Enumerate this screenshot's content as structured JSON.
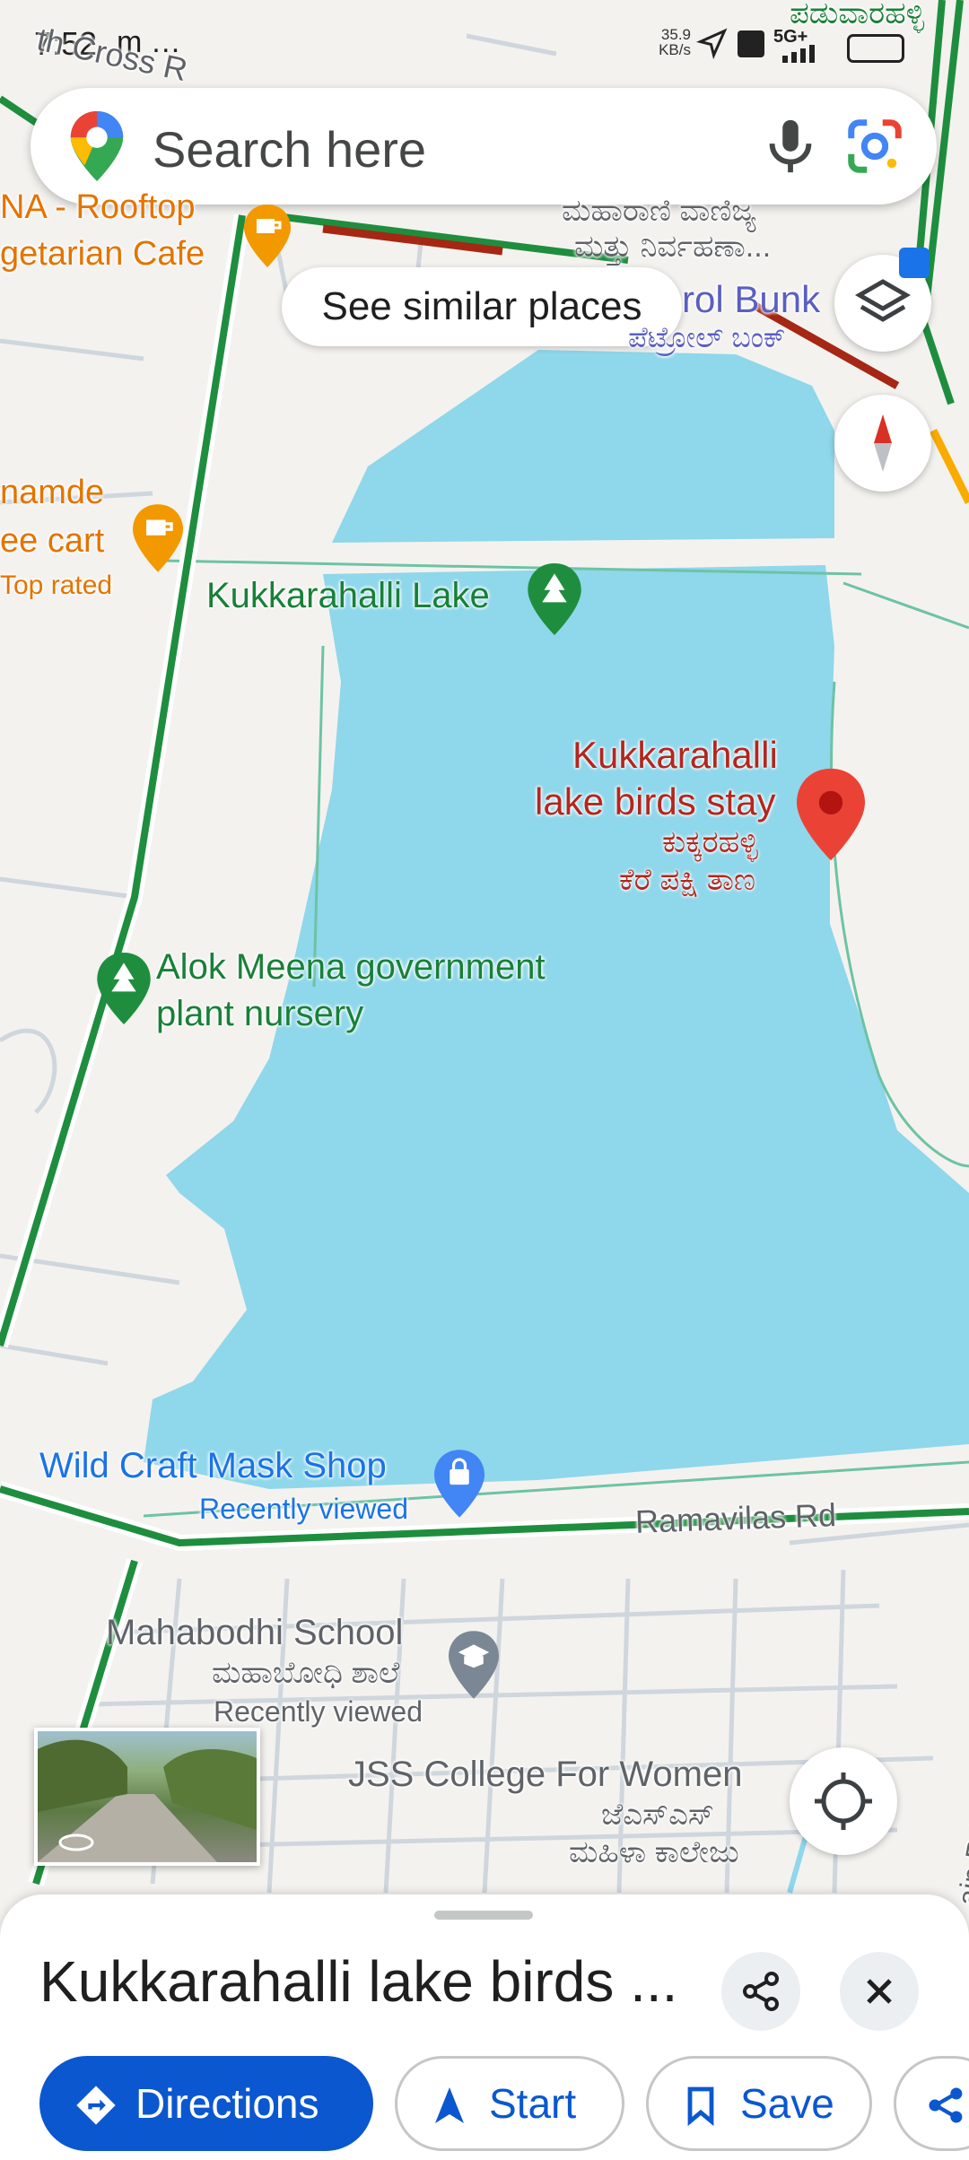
{
  "status_bar": {
    "time": "7:52",
    "app_icons": "m …",
    "net_speed_value": "35.9",
    "net_speed_unit": "KB/s",
    "signal_text": "5G+"
  },
  "search": {
    "placeholder": "Search here"
  },
  "chip": {
    "label": "See similar places"
  },
  "map_labels": {
    "cross_road": "th Cross R",
    "cafe1_line1": "NA - Rooftop",
    "cafe1_line2": "getarian Cafe",
    "kannada_top1": "ಮಹಾರಾಣಿ ವಾಣಿಜ್ಯ",
    "kannada_top2": "ಮತ್ತು ನಿರ್ವಹಣಾ...",
    "kannada_corner": "ಪಡುವಾರಹಳ್ಳಿ",
    "petrol_en": "rol Bunk",
    "petrol_kn": "ಪೆಟ್ರೋಲ್ ಬಂಕ್",
    "cafe2_line1": "namde",
    "cafe2_line2": "ee cart",
    "cafe2_line3": "Top rated",
    "lake": "Kukkarahalli Lake",
    "birds_en1": "Kukkarahalli",
    "birds_en2": "lake birds stay",
    "birds_kn1": "ಕುಕ್ಕರಹಳ್ಳಿ",
    "birds_kn2": "ಕೆರೆ ಪಕ್ಷಿ ತಾಣ",
    "nursery1": "Alok Meena government",
    "nursery2": "plant nursery",
    "mask_shop": "Wild Craft Mask Shop",
    "mask_sub": "Recently viewed",
    "road": "Ramavilas Rd",
    "school_en": "Mahabodhi School",
    "school_kn": "ಮಹಾಬೋಧಿ ಶಾಲೆ",
    "school_sub": "Recently viewed",
    "college_en": "JSS College For Women",
    "college_kn1": "ಜೆಎಸ್‌ಎಸ್",
    "college_kn2": "ಮಹಿಳಾ ಕಾಲೇಜು",
    "main_rd": "ain Rd"
  },
  "sheet": {
    "title": "Kukkarahalli lake birds ...",
    "directions_label": "Directions",
    "start_label": "Start",
    "save_label": "Save"
  },
  "colors": {
    "water": "#8fd7eb",
    "road_green": "#1e8e3e",
    "traffic_red": "#a52714",
    "accent_blue": "#0b57d0",
    "pin_red": "#ea4335"
  }
}
